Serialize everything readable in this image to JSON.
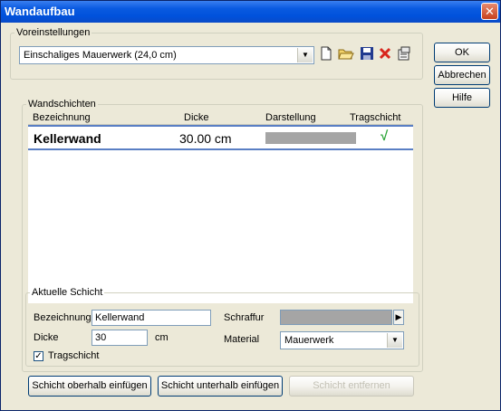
{
  "window": {
    "title": "Wandaufbau"
  },
  "presets": {
    "legend": "Voreinstellungen",
    "selected": "Einschaliges Mauerwerk (24,0 cm)"
  },
  "side_buttons": {
    "ok": "OK",
    "cancel": "Abbrechen",
    "help": "Hilfe"
  },
  "layers": {
    "legend": "Wandschichten",
    "headers": {
      "name": "Bezeichnung",
      "thickness": "Dicke",
      "display": "Darstellung",
      "load_bearing": "Tragschicht"
    },
    "rows": [
      {
        "name": "Kellerwand",
        "thickness": "30.00 cm",
        "display_color": "#a5a5a5",
        "load_bearing": "√"
      }
    ]
  },
  "current_layer": {
    "legend": "Aktuelle Schicht",
    "name_label": "Bezeichnung",
    "name_value": "Kellerwand",
    "thickness_label": "Dicke",
    "thickness_value": "30",
    "unit": "cm",
    "hatch_label": "Schraffur",
    "material_label": "Material",
    "material_value": "Mauerwerk",
    "load_bearing_label": "Tragschicht",
    "load_bearing_checked": "✓"
  },
  "bottom_buttons": {
    "insert_above": "Schicht oberhalb einfügen",
    "insert_below": "Schicht unterhalb einfügen",
    "remove": "Schicht entfernen"
  },
  "colors": {
    "titlebar": "#0052dc",
    "selection": "#5a7fc4",
    "check": "#2ea63a",
    "hatch": "#a5a5a5"
  }
}
